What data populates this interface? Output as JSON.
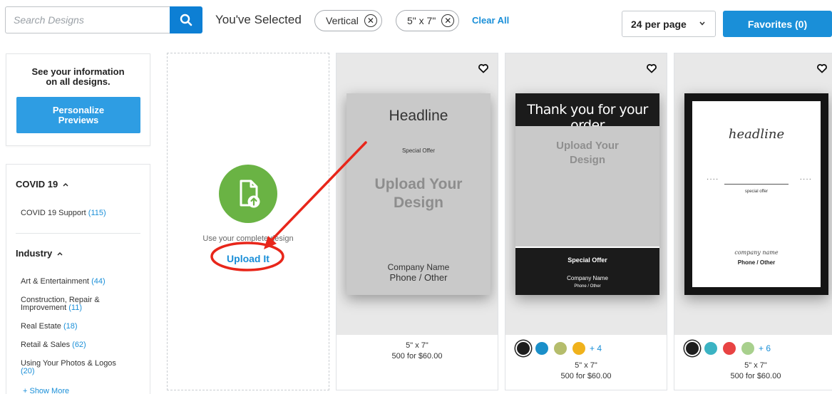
{
  "search": {
    "placeholder": "Search Designs",
    "value": ""
  },
  "filters": {
    "label": "You've Selected",
    "chips": [
      "Vertical",
      "5\" x 7\""
    ],
    "clear_all": "Clear All"
  },
  "per_page": {
    "label": "24 per page"
  },
  "favorites": {
    "label": "Favorites (0)"
  },
  "sidebar": {
    "personalize": {
      "title": "See your information\non all designs.",
      "button": "Personalize\nPreviews"
    },
    "sections": [
      {
        "heading": "COVID 19",
        "items": [
          {
            "label": "COVID 19 Support",
            "count": "(115)"
          }
        ]
      },
      {
        "heading": "Industry",
        "items": [
          {
            "label": "Art & Entertainment",
            "count": "(44)"
          },
          {
            "label": "Construction, Repair & Improvement",
            "count": "(11)"
          },
          {
            "label": "Real Estate",
            "count": "(18)"
          },
          {
            "label": "Retail & Sales",
            "count": "(62)"
          },
          {
            "label": "Using Your Photos & Logos",
            "count": "(20)"
          }
        ]
      }
    ],
    "show_more": "+ Show More"
  },
  "upload": {
    "description": "Use your complete design",
    "link": "Upload It"
  },
  "products": [
    {
      "design": {
        "headline": "Headline",
        "offer": "Special Offer",
        "upload": "Upload Your\nDesign",
        "company": "Company Name",
        "phone": "Phone / Other"
      },
      "size": "5\" x 7\"",
      "price": "500 for $60.00",
      "swatches": [],
      "more_colors": ""
    },
    {
      "design": {
        "headline": "Thank you for your order",
        "upload": "Upload Your\nDesign",
        "offer": "Special Offer",
        "company": "Company Name",
        "phone": "Phone / Other"
      },
      "size": "5\" x 7\"",
      "price": "500 for $60.00",
      "swatches": [
        "#1e1e1e",
        "#1a8fc9",
        "#b5bd6c",
        "#f0b21c"
      ],
      "more_colors": "+ 4"
    },
    {
      "design": {
        "headline": "headline",
        "offer": "special offer",
        "company": "company name",
        "phone": "Phone / Other"
      },
      "size": "5\" x 7\"",
      "price": "500 for $60.00",
      "swatches": [
        "#1e1e1e",
        "#3bb3c3",
        "#e84343",
        "#a8d08d"
      ],
      "more_colors": "+ 6"
    }
  ],
  "colors": {
    "accent": "#1a8fd8",
    "upload_green": "#6ab344",
    "annotation_red": "#e8261a"
  }
}
